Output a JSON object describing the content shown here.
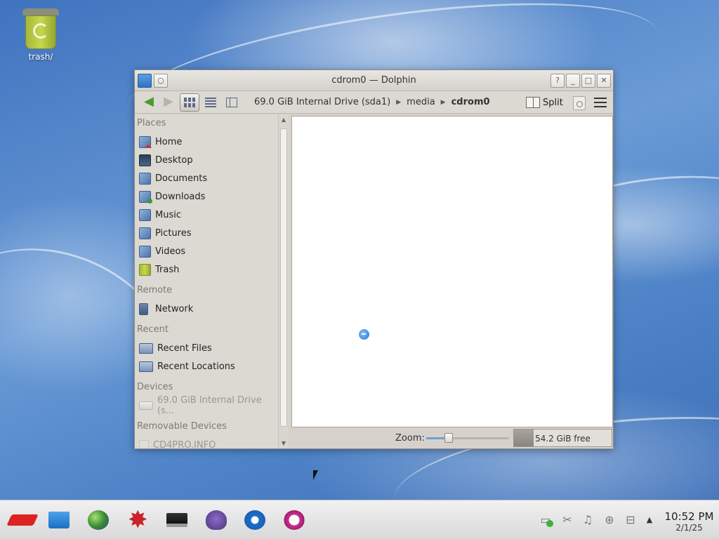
{
  "desktop": {
    "trash_label": "trash/"
  },
  "window": {
    "title": "cdrom0 — Dolphin",
    "controls": {
      "help": "?",
      "minimize": "_",
      "maximize": "□",
      "close": "✕"
    }
  },
  "toolbar": {
    "breadcrumb": [
      "69.0 GiB Internal Drive (sda1)",
      "media",
      "cdrom0"
    ],
    "split_label": "Split",
    "view_modes": [
      "icons",
      "compact",
      "details"
    ],
    "active_view": "icons"
  },
  "places": {
    "headers": {
      "places": "Places",
      "remote": "Remote",
      "recent": "Recent",
      "devices": "Devices",
      "removable": "Removable Devices"
    },
    "items": {
      "home": "Home",
      "desktop": "Desktop",
      "documents": "Documents",
      "downloads": "Downloads",
      "music": "Music",
      "pictures": "Pictures",
      "videos": "Videos",
      "trash": "Trash",
      "network": "Network",
      "recent_files": "Recent Files",
      "recent_locations": "Recent Locations",
      "internal_drive": "69.0 GiB Internal Drive (s...",
      "cd4pro": "CD4PRO.INFO"
    }
  },
  "statusbar": {
    "zoom_label": "Zoom:",
    "zoom_level": 0.27,
    "free_space": "54.2 GiB free",
    "used_fraction": 0.2
  },
  "taskbar": {
    "clock_time": "10:52 PM",
    "clock_date": "2/1/25"
  },
  "colors": {
    "desktop_bg": "#4a7fc4",
    "window_bg": "#d6d2cb",
    "accent": "#2f72c2"
  }
}
